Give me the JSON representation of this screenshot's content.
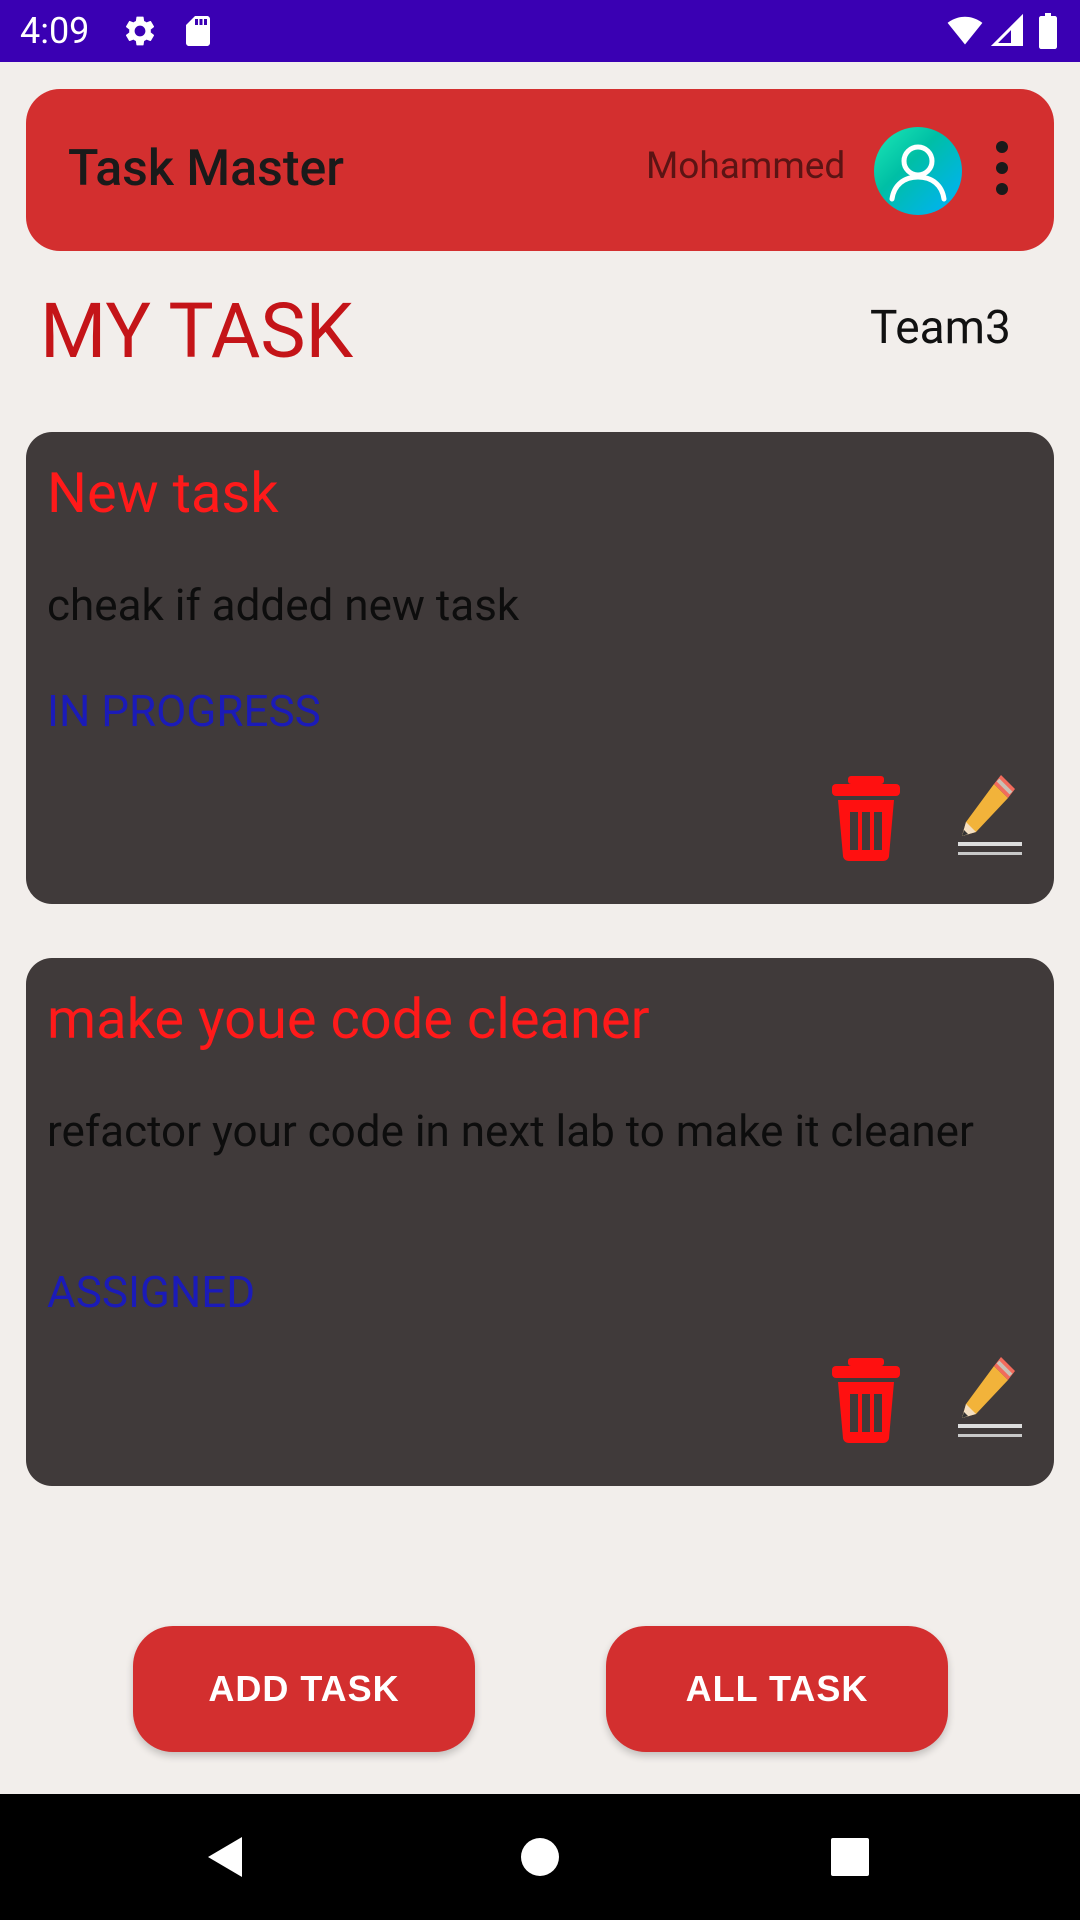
{
  "status_bar": {
    "time": "4:09",
    "background": "#3a00b3",
    "left_icons": [
      "settings-gear-icon",
      "sd-card-icon"
    ],
    "right_icons": [
      "wifi-icon",
      "cellular-signal-icon",
      "battery-icon"
    ]
  },
  "toolbar": {
    "title": "Task Master",
    "username": "Mohammed",
    "avatar_icon": "person-avatar-icon",
    "menu_icon": "more-vert-icon",
    "background": "#d32f2f"
  },
  "header": {
    "title": "MY TASK",
    "team": "Team3"
  },
  "tasks": [
    {
      "title": "New task",
      "description": "cheak if added new task",
      "status": "IN PROGRESS",
      "delete_icon": "trash-icon",
      "edit_icon": "pencil-icon"
    },
    {
      "title": "make youe code cleaner",
      "description": "refactor your code in next lab to make it cleaner",
      "status": "ASSIGNED",
      "delete_icon": "trash-icon",
      "edit_icon": "pencil-icon"
    }
  ],
  "buttons": {
    "add_task": "ADD TASK",
    "all_task": "ALL TASK"
  },
  "nav_bar": {
    "icons": [
      "back-triangle-icon",
      "home-circle-icon",
      "recents-square-icon"
    ]
  },
  "colors": {
    "accent_red": "#d32f2f",
    "card_background": "#403a3a",
    "task_title": "#ff1a1a",
    "status_text": "#1b1bb8",
    "page_background": "#f2eeeb"
  }
}
